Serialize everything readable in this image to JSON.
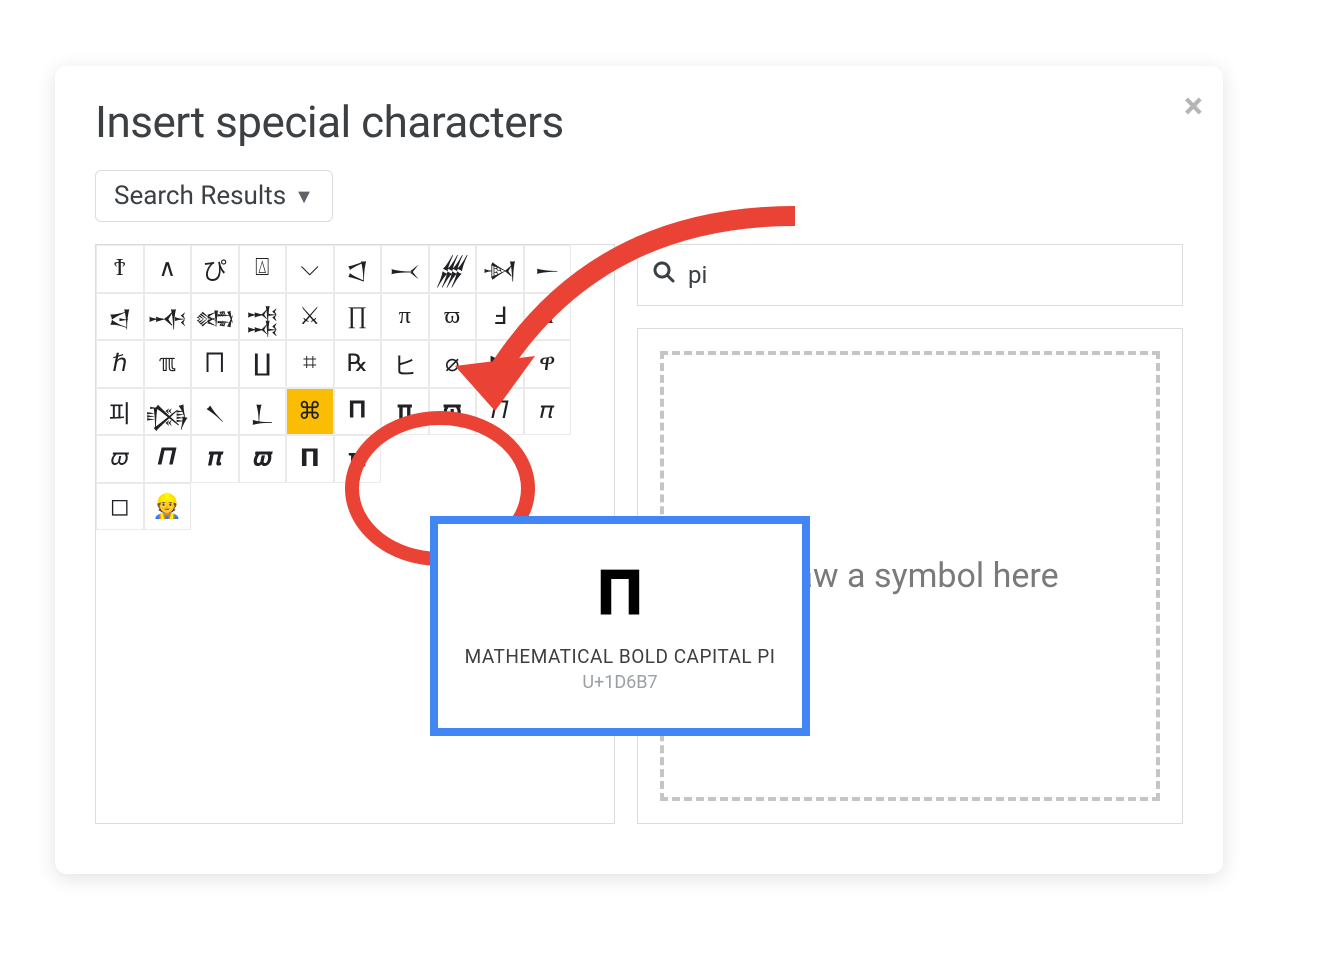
{
  "dialog": {
    "title": "Insert special characters",
    "close_glyph": "×",
    "dropdown_label": "Search Results"
  },
  "search": {
    "value": "pi"
  },
  "draw": {
    "prompt": "Draw a symbol here"
  },
  "tooltip": {
    "glyph": "𝚷",
    "name": "MATHEMATICAL BOLD CAPITAL PI",
    "codepoint": "U+1D6B7"
  },
  "grid": {
    "columns": 10,
    "highlighted_index": 34,
    "cells": [
      "Ϯ",
      "∧",
      "ぴ",
      "⍍",
      "⌵",
      "𒀶",
      "𒁁",
      "𒁂",
      "𒀵",
      "𒀸",
      "𒁀",
      "𒁄",
      "𒀷",
      "𒁅",
      "⚔",
      "∏",
      "π",
      "ϖ",
      "Ⅎ",
      "ᴨ",
      "ℏ",
      "ℼ",
      "⨅",
      "∐",
      "⌗",
      "℞",
      "ヒ",
      "⌀",
      "▶",
      "ዋ",
      "피",
      "𒁆",
      "𒀹",
      "𒁇",
      "⌘",
      "𝚷",
      "𝛑",
      "𝛡",
      "𝛱",
      "𝜋",
      "𝜛",
      "𝜫",
      "𝝅",
      "𝝕",
      "𝝥",
      "𝝿",
      "",
      "",
      "",
      "",
      "◻",
      "👷",
      "",
      "",
      "",
      "",
      "",
      "",
      "",
      ""
    ]
  }
}
